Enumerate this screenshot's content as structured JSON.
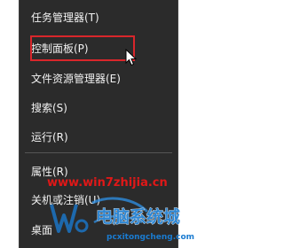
{
  "context_menu": {
    "items": [
      {
        "label": "任务管理器(T)"
      },
      {
        "label": "控制面板(P)"
      },
      {
        "label": "文件资源管理器(E)"
      },
      {
        "label": "搜索(S)"
      },
      {
        "label": "运行(R)"
      },
      {
        "label": "属性(R)"
      },
      {
        "label": "关机或注销(U)"
      },
      {
        "label": "桌面"
      }
    ],
    "highlighted_item": "控制面板(P)"
  },
  "watermark": {
    "url": "www.win7zhijia.cn",
    "logo_text": "电脑系统城",
    "domain_text": "pcxitongcheng.com"
  },
  "colors": {
    "menu_background": "#2b2b2b",
    "menu_text": "#f2f2f2",
    "highlight_border": "#d9262b",
    "watermark_red": "#e01818",
    "watermark_blue": "#1a7bd0"
  }
}
